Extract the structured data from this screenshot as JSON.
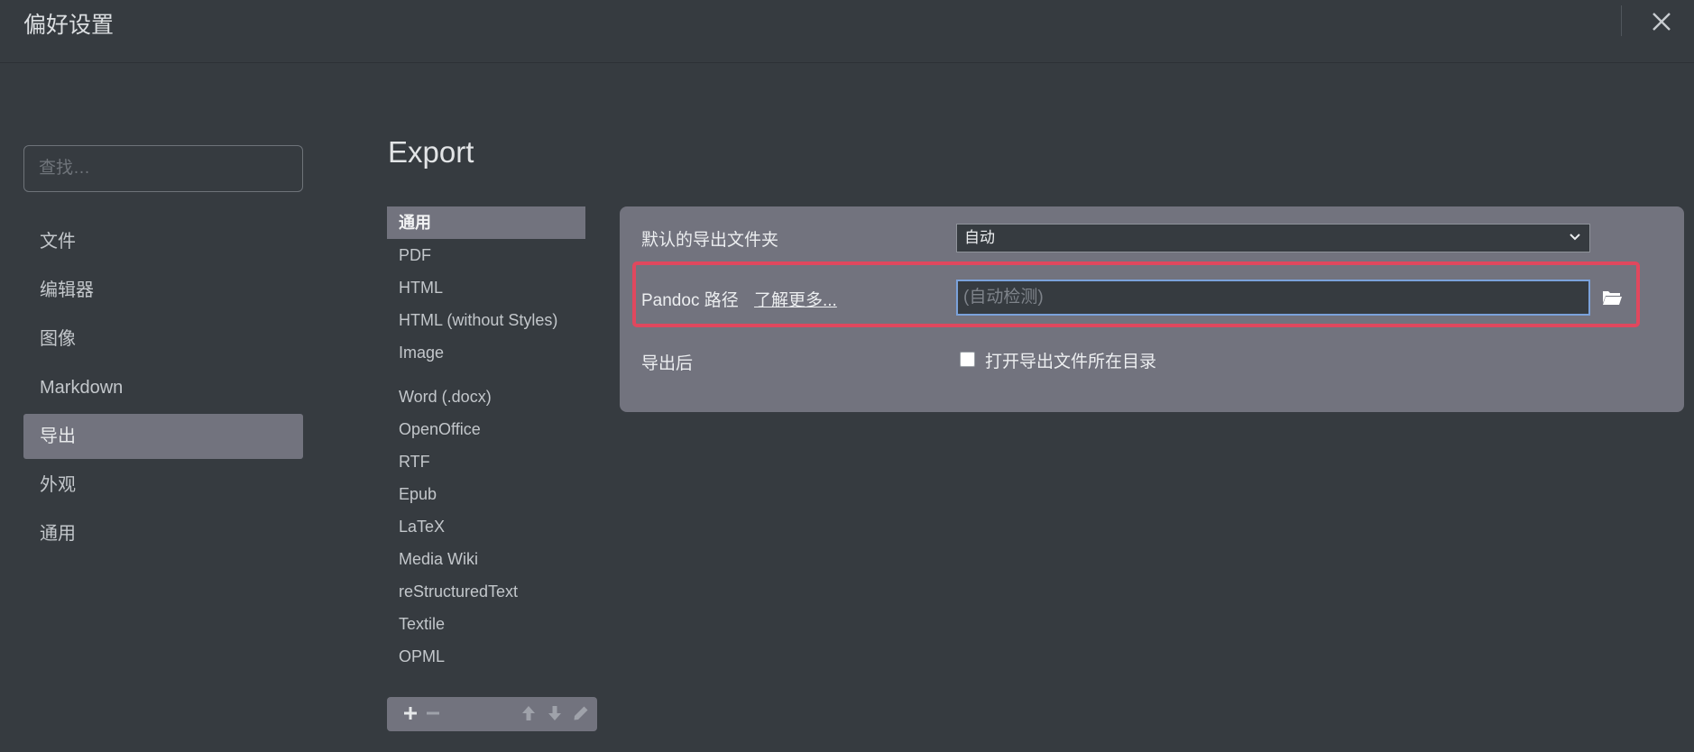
{
  "window": {
    "title": "偏好设置",
    "close_icon": "close-icon"
  },
  "search": {
    "placeholder": "查找…"
  },
  "sidebar": {
    "items": [
      {
        "label": "文件",
        "active": false
      },
      {
        "label": "编辑器",
        "active": false
      },
      {
        "label": "图像",
        "active": false
      },
      {
        "label": "Markdown",
        "active": false
      },
      {
        "label": "导出",
        "active": true
      },
      {
        "label": "外观",
        "active": false
      },
      {
        "label": "通用",
        "active": false
      }
    ]
  },
  "main": {
    "title": "Export",
    "subnav": {
      "items": [
        {
          "label": "通用",
          "active": true
        },
        {
          "label": "PDF"
        },
        {
          "label": "HTML"
        },
        {
          "label": "HTML (without Styles)"
        },
        {
          "label": "Image"
        },
        {
          "label": "Word (.docx)"
        },
        {
          "label": "OpenOffice"
        },
        {
          "label": "RTF"
        },
        {
          "label": "Epub"
        },
        {
          "label": "LaTeX"
        },
        {
          "label": "Media Wiki"
        },
        {
          "label": "reStructuredText"
        },
        {
          "label": "Textile"
        },
        {
          "label": "OPML"
        }
      ],
      "toolbar_icons": [
        "plus-icon",
        "minus-icon",
        "arrow-up-icon",
        "arrow-down-icon",
        "pencil-icon"
      ]
    },
    "settings": {
      "default_folder": {
        "label": "默认的导出文件夹",
        "value": "自动"
      },
      "pandoc": {
        "label": "Pandoc 路径",
        "link": "了解更多...",
        "value": "",
        "placeholder": "(自动检测)"
      },
      "after_export": {
        "label": "导出后",
        "checkbox_label": "打开导出文件所在目录",
        "checked": false
      }
    }
  },
  "colors": {
    "background": "#363b40",
    "panel": "#72737e",
    "highlight": "#e0485e",
    "focus": "#7ba2db"
  }
}
